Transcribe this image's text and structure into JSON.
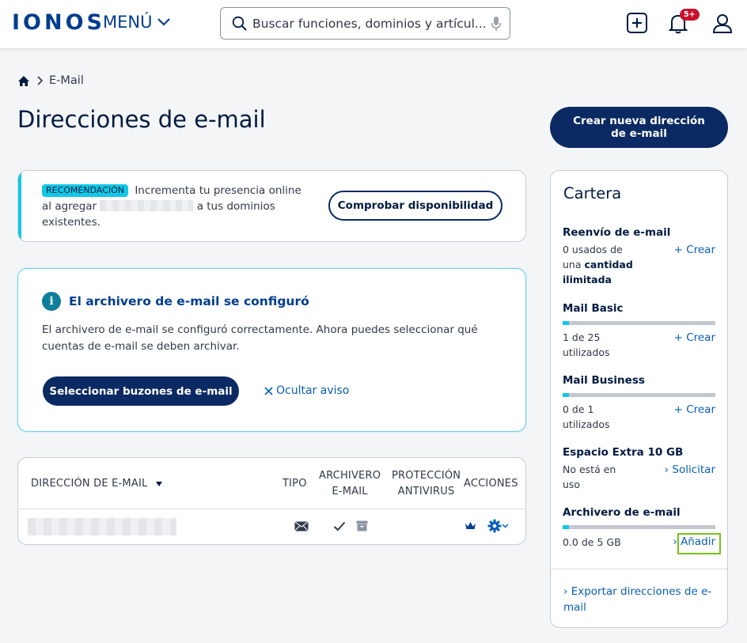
{
  "header": {
    "logo": "IONOS",
    "menu_label": "MENÚ",
    "search_placeholder": "Buscar funciones, dominios y artícul...",
    "notifications_badge": "5+"
  },
  "breadcrumb": {
    "current": "E-Mail"
  },
  "page": {
    "title": "Direcciones de e-mail",
    "create_button": "Crear nueva dirección de e-mail"
  },
  "recommendation": {
    "badge": "RECOMENDACIÓN",
    "text_part1": "Incrementa tu presencia online al agregar",
    "text_part2": "a tus dominios existentes.",
    "button": "Comprobar disponibilidad"
  },
  "info": {
    "title": "El archivero de e-mail se configuró",
    "body": "El archivero de e-mail se configuró correctamente. Ahora puedes seleccionar qué cuentas de e-mail se deben archivar.",
    "select_button": "Seleccionar buzones de e-mail",
    "hide_link": "Ocultar aviso"
  },
  "table": {
    "columns": {
      "address": "DIRECCIÓN DE E-MAIL",
      "type": "TIPO",
      "archive_l1": "ARCHIVERO",
      "archive_l2": "E-MAIL",
      "protection_l1": "PROTECCIÓN",
      "protection_l2": "ANTIVIRUS",
      "actions": "ACCIONES"
    }
  },
  "cartera": {
    "title": "Cartera",
    "sections": [
      {
        "title": "Reenvío de e-mail",
        "text_l1": "0 usados de",
        "text_l2a": "una ",
        "text_l2b": "cantidad",
        "text_l3": "ilimitada",
        "link": "Crear"
      },
      {
        "title": "Mail Basic",
        "text_l1": "1 de 25",
        "text_l2": "utilizados",
        "link": "Crear",
        "usage": 0.04
      },
      {
        "title": "Mail Business",
        "text_l1": "0 de 1",
        "text_l2": "utilizados",
        "link": "Crear",
        "usage": 0.04
      },
      {
        "title": "Espacio Extra 10 GB",
        "text_l1": "No está en",
        "text_l2": "uso",
        "link": "Solicitar"
      },
      {
        "title": "Archivero de e-mail",
        "text_l1": "0.0 de 5 GB",
        "link": "Añadir",
        "usage": 0.04
      }
    ],
    "export_link": "Exportar direcciones de e-mail"
  },
  "colors": {
    "brand_dark": "#0b2a63",
    "accent_cyan": "#11c7e6",
    "link_blue": "#0b5fb4",
    "highlight_green": "#79c21a"
  }
}
